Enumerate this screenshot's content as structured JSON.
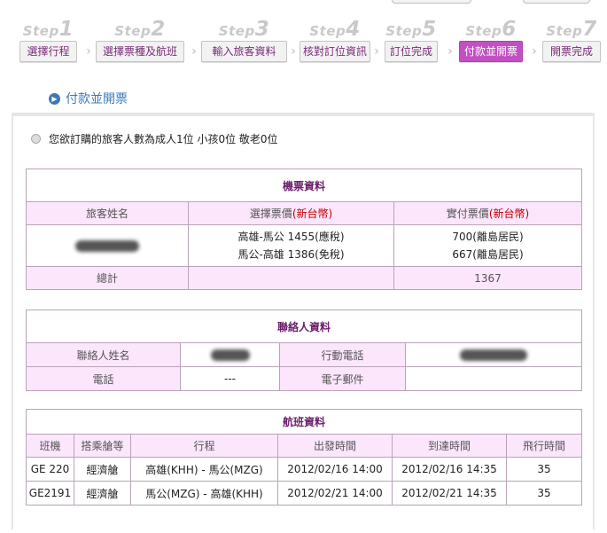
{
  "steps": [
    {
      "num": "1",
      "label": "選擇行程",
      "active": false
    },
    {
      "num": "2",
      "label": "選擇票種及航班",
      "active": false
    },
    {
      "num": "3",
      "label": "輸入旅客資料",
      "active": false
    },
    {
      "num": "4",
      "label": "核對訂位資訊",
      "active": false
    },
    {
      "num": "5",
      "label": "訂位完成",
      "active": false
    },
    {
      "num": "6",
      "label": "付款並開票",
      "active": true
    },
    {
      "num": "7",
      "label": "開票完成",
      "active": false
    }
  ],
  "step_word": "Step",
  "heading": "付款並開票",
  "notice": "您欲訂購的旅客人數為成人1位 小孩0位 敬老0位",
  "ticket": {
    "title": "機票資料",
    "col_passenger": "旅客姓名",
    "col_fare": "選擇票價",
    "col_paid": "實付票價",
    "currency": "(新台幣)",
    "fare_line1": "高雄-馬公 1455(應稅)",
    "fare_line2": "馬公-高雄 1386(免稅)",
    "paid_line1": "700(離島居民)",
    "paid_line2": "667(離島居民)",
    "total_label": "總計",
    "total_value": "1367"
  },
  "contact": {
    "title": "聯絡人資料",
    "name_label": "聯絡人姓名",
    "mobile_label": "行動電話",
    "phone_label": "電話",
    "phone_value": "---",
    "email_label": "電子郵件",
    "email_value": ""
  },
  "flights": {
    "title": "航班資料",
    "headers": [
      "班機",
      "搭乘艙等",
      "行程",
      "出發時間",
      "到達時間",
      "飛行時間"
    ],
    "rows": [
      [
        "GE 220",
        "經濟艙",
        "高雄(KHH) - 馬公(MZG)",
        "2012/02/16 14:00",
        "2012/02/16 14:35",
        "35"
      ],
      [
        "GE2191",
        "經濟艙",
        "馬公(MZG) - 高雄(KHH)",
        "2012/02/21 14:00",
        "2012/02/21 14:35",
        "35"
      ]
    ]
  },
  "colors": {
    "accent": "#c24fc3",
    "header_bg": "#fbe6fb",
    "link": "#3d79b8",
    "title": "#6b1f6b"
  }
}
